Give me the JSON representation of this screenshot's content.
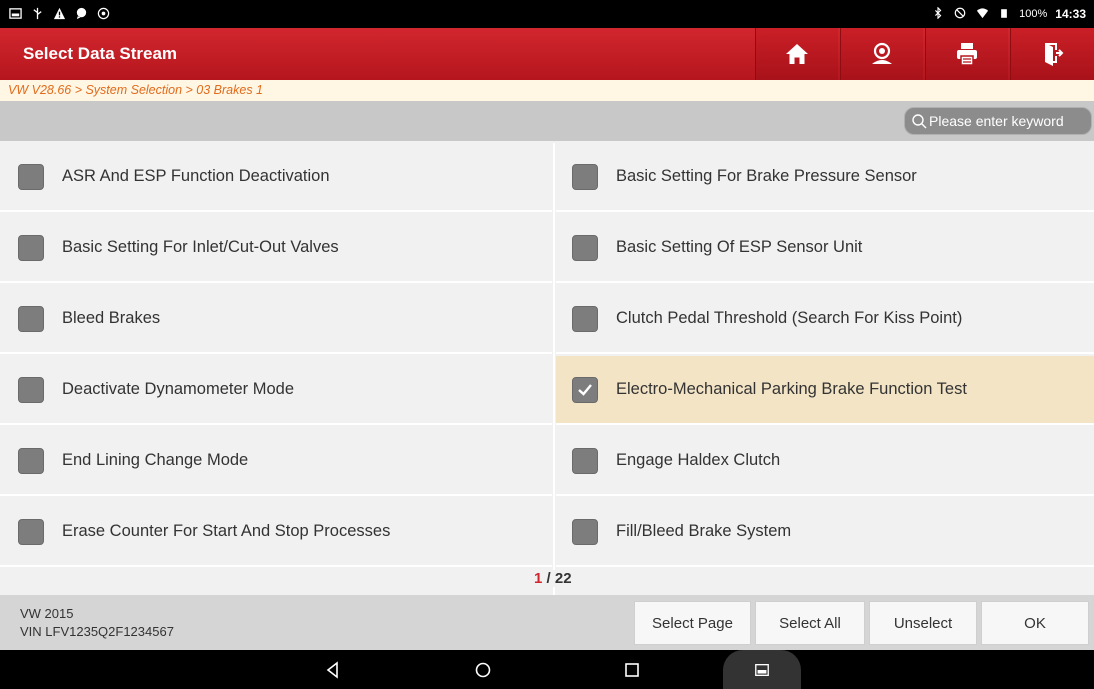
{
  "statusbar": {
    "icons_left": [
      "notification-icon",
      "usb-icon",
      "warning-icon",
      "chat-icon",
      "settings-icon"
    ],
    "icons_right": [
      "bluetooth-icon",
      "blocked-icon",
      "wifi-icon",
      "battery-icon"
    ],
    "battery": "100%",
    "time": "14:33"
  },
  "header": {
    "title": "Select Data Stream",
    "buttons": [
      "home-icon",
      "support-icon",
      "print-icon",
      "exit-icon"
    ]
  },
  "breadcrumb": "VW V28.66 > System Selection > 03 Brakes 1",
  "search": {
    "placeholder": "Please enter keyword"
  },
  "list": {
    "items": [
      {
        "label": "ASR And ESP Function Deactivation",
        "checked": false
      },
      {
        "label": "Basic Setting For Brake Pressure Sensor",
        "checked": false
      },
      {
        "label": "Basic Setting For Inlet/Cut-Out Valves",
        "checked": false
      },
      {
        "label": "Basic Setting Of ESP Sensor Unit",
        "checked": false
      },
      {
        "label": "Bleed Brakes",
        "checked": false
      },
      {
        "label": "Clutch Pedal Threshold (Search For Kiss Point)",
        "checked": false
      },
      {
        "label": "Deactivate Dynamometer Mode",
        "checked": false
      },
      {
        "label": "Electro-Mechanical Parking Brake Function Test",
        "checked": true
      },
      {
        "label": "End Lining Change Mode",
        "checked": false
      },
      {
        "label": "Engage Haldex Clutch",
        "checked": false
      },
      {
        "label": "Erase Counter For Start And Stop Processes",
        "checked": false
      },
      {
        "label": "Fill/Bleed Brake System",
        "checked": false
      }
    ]
  },
  "pager": {
    "current": "1",
    "total": "/ 22"
  },
  "footer": {
    "vehicle_line1": "VW  2015",
    "vehicle_line2": "VIN LFV1235Q2F1234567",
    "buttons": [
      "Select Page",
      "Select All",
      "Unselect",
      "OK"
    ]
  },
  "colors": {
    "header": "#c41d25",
    "breadcrumb_text": "#e26a1c",
    "selected_row": "#f3e4c6",
    "checkbox": "#7d7d7d"
  }
}
